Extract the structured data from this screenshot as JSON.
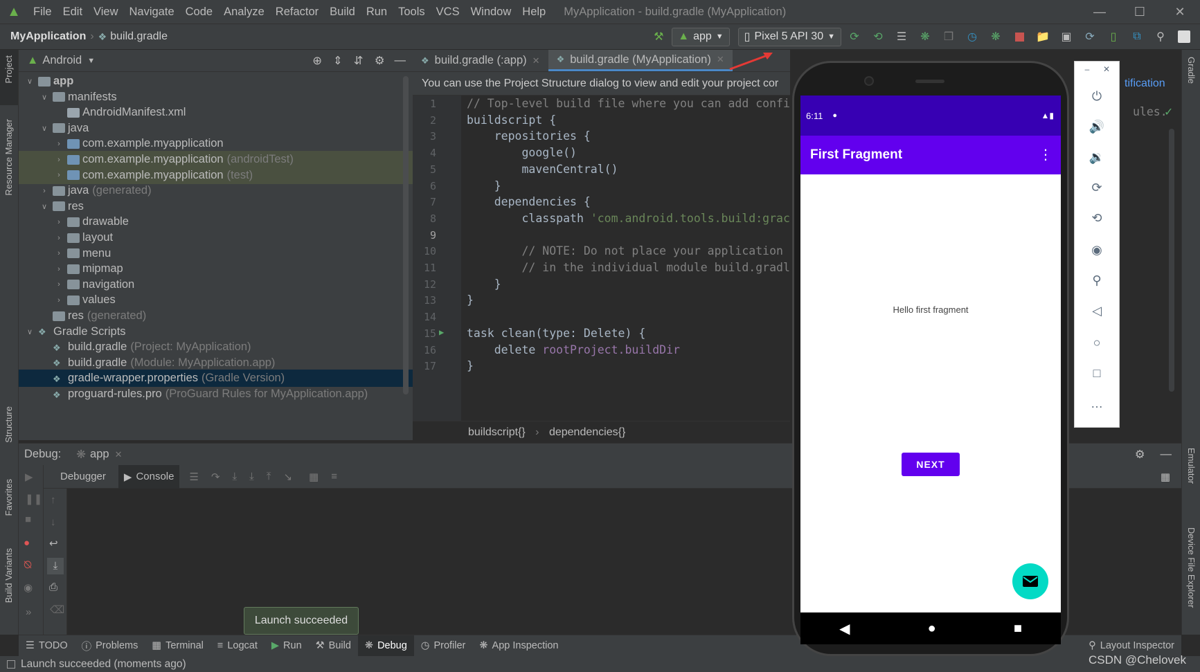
{
  "menubar": {
    "items": [
      "File",
      "Edit",
      "View",
      "Navigate",
      "Code",
      "Analyze",
      "Refactor",
      "Build",
      "Run",
      "Tools",
      "VCS",
      "Window",
      "Help"
    ],
    "title": "MyApplication - build.gradle (MyApplication)"
  },
  "navbar": {
    "project": "MyApplication",
    "file": "build.gradle",
    "run_config": "app",
    "device": "Pixel 5 API 30"
  },
  "left_strip": {
    "project": "Project",
    "resource_manager": "Resource Manager",
    "structure": "Structure",
    "favorites": "Favorites",
    "build_variants": "Build Variants"
  },
  "right_strip": {
    "gradle": "Gradle",
    "emulator": "Emulator",
    "device_file_explorer": "Device File Explorer"
  },
  "project_panel": {
    "view": "Android",
    "tree": [
      {
        "label": "app",
        "extra": "",
        "indent": 0,
        "arrow": "down"
      },
      {
        "label": "manifests",
        "extra": "",
        "indent": 1,
        "arrow": "down"
      },
      {
        "label": "AndroidManifest.xml",
        "extra": "",
        "indent": 2,
        "arrow": ""
      },
      {
        "label": "java",
        "extra": "",
        "indent": 1,
        "arrow": "down"
      },
      {
        "label": "com.example.myapplication",
        "extra": "",
        "indent": 2,
        "arrow": "right"
      },
      {
        "label": "com.example.myapplication",
        "extra": "(androidTest)",
        "indent": 2,
        "arrow": "right"
      },
      {
        "label": "com.example.myapplication",
        "extra": "(test)",
        "indent": 2,
        "arrow": "right"
      },
      {
        "label": "java",
        "extra": "(generated)",
        "indent": 1,
        "arrow": "right"
      },
      {
        "label": "res",
        "extra": "",
        "indent": 1,
        "arrow": "down"
      },
      {
        "label": "drawable",
        "extra": "",
        "indent": 2,
        "arrow": "right"
      },
      {
        "label": "layout",
        "extra": "",
        "indent": 2,
        "arrow": "right"
      },
      {
        "label": "menu",
        "extra": "",
        "indent": 2,
        "arrow": "right"
      },
      {
        "label": "mipmap",
        "extra": "",
        "indent": 2,
        "arrow": "right"
      },
      {
        "label": "navigation",
        "extra": "",
        "indent": 2,
        "arrow": "right"
      },
      {
        "label": "values",
        "extra": "",
        "indent": 2,
        "arrow": "right"
      },
      {
        "label": "res",
        "extra": "(generated)",
        "indent": 1,
        "arrow": ""
      },
      {
        "label": "Gradle Scripts",
        "extra": "",
        "indent": 0,
        "arrow": "down"
      },
      {
        "label": "build.gradle",
        "extra": "(Project: MyApplication)",
        "indent": 1,
        "arrow": ""
      },
      {
        "label": "build.gradle",
        "extra": "(Module: MyApplication.app)",
        "indent": 1,
        "arrow": ""
      },
      {
        "label": "gradle-wrapper.properties",
        "extra": "(Gradle Version)",
        "indent": 1,
        "arrow": ""
      },
      {
        "label": "proguard-rules.pro",
        "extra": "(ProGuard Rules for MyApplication.app)",
        "indent": 1,
        "arrow": ""
      }
    ]
  },
  "editor": {
    "tabs": [
      {
        "label": "build.gradle (:app)"
      },
      {
        "label": "build.gradle (MyApplication)"
      }
    ],
    "banner": "You can use the Project Structure dialog to view and edit your project cor",
    "banner_link": "tification",
    "line_numbers": [
      "1",
      "2",
      "3",
      "4",
      "5",
      "6",
      "7",
      "8",
      "9",
      "10",
      "11",
      "12",
      "13",
      "14",
      "15",
      "16",
      "17"
    ],
    "lines": [
      "// Top-level build file where you can add confi",
      "buildscript {",
      "    repositories {",
      "        google()",
      "        mavenCentral()",
      "    }",
      "    dependencies {",
      "        classpath ",
      "",
      "        // NOTE: Do not place your application",
      "        // in the individual module build.gradl",
      "    }",
      "}",
      "",
      "task clean(",
      "    delete ",
      "}"
    ],
    "classpath_str": "'com.android.tools.build:grac",
    "task_tail": "type: Delete) {",
    "delete_field": "rootProject.buildDir",
    "right_text": "ules.",
    "breadcrumb": [
      "buildscript{}",
      "dependencies{}"
    ]
  },
  "debug": {
    "label": "Debug:",
    "config": "app",
    "tabs": [
      "Debugger",
      "Console"
    ]
  },
  "toast": "Launch succeeded",
  "bottom_tabs": [
    "TODO",
    "Problems",
    "Terminal",
    "Logcat",
    "Run",
    "Build",
    "Debug",
    "Profiler",
    "App Inspection"
  ],
  "layout_inspector": "Layout Inspector",
  "status": "Launch succeeded (moments ago)",
  "watermark": "CSDN @Chelovek",
  "phone": {
    "time": "6:11",
    "title": "First Fragment",
    "hello": "Hello first fragment",
    "next": "NEXT"
  },
  "colors": {
    "primary": "#6200ee",
    "primary_dark": "#3700b3",
    "fab": "#03dac5",
    "ide_bg": "#2b2b2b",
    "ide_panel": "#3c3f41"
  }
}
